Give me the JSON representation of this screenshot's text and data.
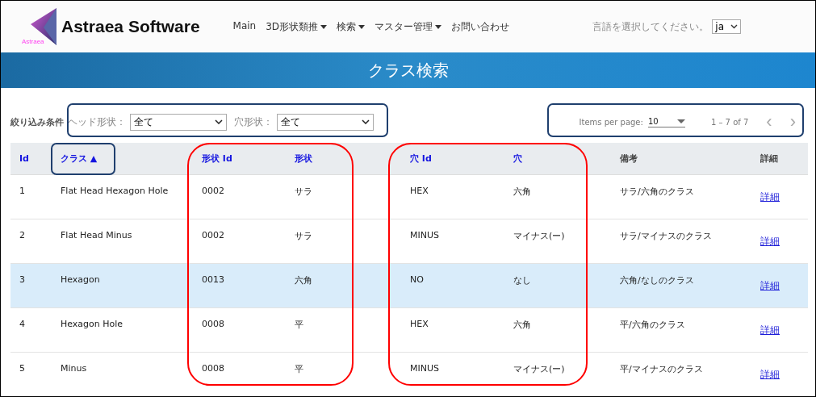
{
  "header": {
    "logo_text": "Astraea",
    "brand": "Astraea Software",
    "nav": [
      {
        "label": "Main",
        "dropdown": false
      },
      {
        "label": "3D形状類推",
        "dropdown": true
      },
      {
        "label": "検索",
        "dropdown": true
      },
      {
        "label": "マスター管理",
        "dropdown": true
      },
      {
        "label": "お問い合わせ",
        "dropdown": false
      }
    ],
    "language_label": "言語を選択してください。",
    "language": "ja"
  },
  "banner": {
    "title": "クラス検索"
  },
  "filters": {
    "label": "絞り込み条件",
    "fields": [
      {
        "label": "ヘッド形状：",
        "value": "全て"
      },
      {
        "label": "穴形状：",
        "value": "全て"
      }
    ]
  },
  "pager": {
    "label": "Items per page:",
    "value": "10",
    "range": "1 – 7 of 7",
    "prev": "‹",
    "next": "›"
  },
  "table": {
    "columns": [
      {
        "label": "Id",
        "sortable": true
      },
      {
        "label": "クラス ▲",
        "sortable": true
      },
      {
        "label": "形状 Id",
        "sortable": true
      },
      {
        "label": "形状",
        "sortable": true
      },
      {
        "label": "穴 Id",
        "sortable": true
      },
      {
        "label": "穴",
        "sortable": true
      },
      {
        "label": "備考",
        "sortable": false
      },
      {
        "label": "詳細",
        "sortable": false
      }
    ],
    "rows": [
      {
        "selected": false,
        "cells": [
          "1",
          "Flat Head Hexagon Hole",
          "0002",
          "サラ",
          "HEX",
          "六角",
          "サラ/六角のクラス"
        ],
        "link": "詳細"
      },
      {
        "selected": false,
        "cells": [
          "2",
          "Flat Head Minus",
          "0002",
          "サラ",
          "MINUS",
          "マイナス(ー)",
          "サラ/マイナスのクラス"
        ],
        "link": "詳細"
      },
      {
        "selected": true,
        "cells": [
          "3",
          "Hexagon",
          "0013",
          "六角",
          "NO",
          "なし",
          "六角/なしのクラス"
        ],
        "link": "詳細"
      },
      {
        "selected": false,
        "cells": [
          "4",
          "Hexagon Hole",
          "0008",
          "平",
          "HEX",
          "六角",
          "平/六角のクラス"
        ],
        "link": "詳細"
      },
      {
        "selected": false,
        "cells": [
          "5",
          "Minus",
          "0008",
          "平",
          "MINUS",
          "マイナス(ー)",
          "平/マイナスのクラス"
        ],
        "link": "詳細"
      }
    ]
  },
  "annotations": [
    {
      "kind": "box",
      "color": "#1f3f6e"
    },
    {
      "kind": "box",
      "color": "#1f3f6e"
    },
    {
      "kind": "box",
      "color": "#1f3f6e"
    },
    {
      "kind": "rounded",
      "color": "#ff0000"
    },
    {
      "kind": "rounded",
      "color": "#ff0000"
    }
  ]
}
